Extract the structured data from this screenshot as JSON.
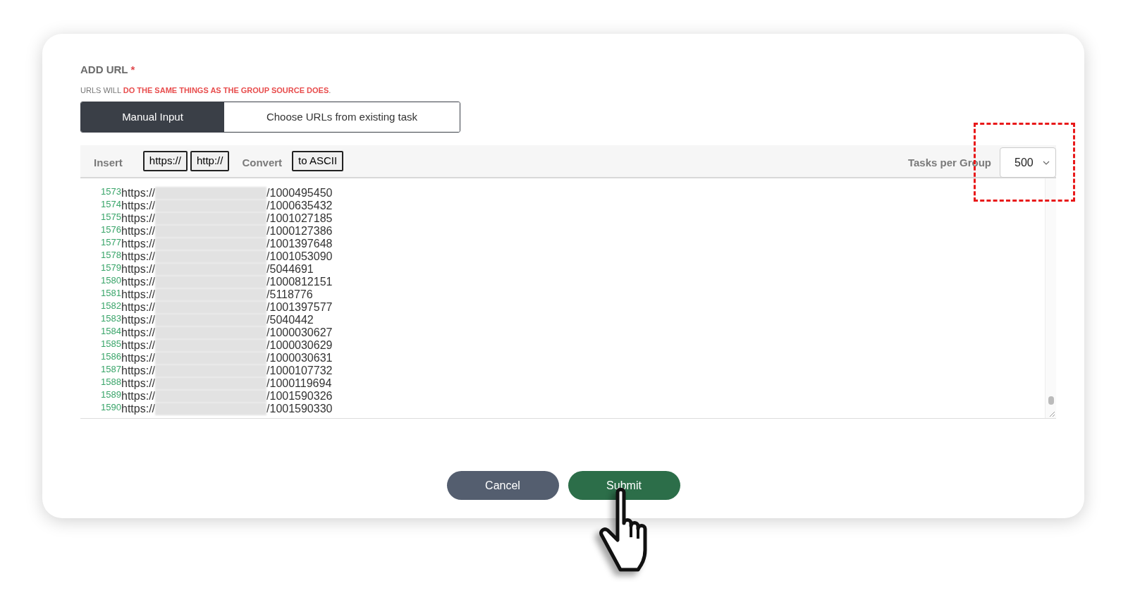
{
  "section": {
    "title": "ADD URL",
    "required_mark": "*",
    "notice": {
      "prefix": "URLS WILL ",
      "emphasis": "DO THE SAME THINGS AS THE GROUP SOURCE DOES",
      "suffix": "."
    }
  },
  "tabs": [
    {
      "label": "Manual Input",
      "selected": true
    },
    {
      "label": "Choose URLs from existing task",
      "selected": false
    }
  ],
  "toolbar": {
    "insert_label": "Insert",
    "insert_buttons": [
      "https://",
      "http://"
    ],
    "convert_label": "Convert",
    "convert_buttons": [
      "to ASCII"
    ],
    "tasks_label": "Tasks per Group",
    "tasks_value": "500"
  },
  "editor": {
    "lines": [
      {
        "number": "1573",
        "prefix": "https://",
        "suffix": "/1000495450"
      },
      {
        "number": "1574",
        "prefix": "https://",
        "suffix": "/1000635432"
      },
      {
        "number": "1575",
        "prefix": "https://",
        "suffix": "/1001027185"
      },
      {
        "number": "1576",
        "prefix": "https://",
        "suffix": "/1000127386"
      },
      {
        "number": "1577",
        "prefix": "https://",
        "suffix": "/1001397648"
      },
      {
        "number": "1578",
        "prefix": "https://",
        "suffix": "/1001053090"
      },
      {
        "number": "1579",
        "prefix": "https://",
        "suffix": "/5044691"
      },
      {
        "number": "1580",
        "prefix": "https://",
        "suffix": "/1000812151"
      },
      {
        "number": "1581",
        "prefix": "https://",
        "suffix": "/5118776"
      },
      {
        "number": "1582",
        "prefix": "https://",
        "suffix": "/1001397577"
      },
      {
        "number": "1583",
        "prefix": "https://",
        "suffix": "/5040442"
      },
      {
        "number": "1584",
        "prefix": "https://",
        "suffix": "/1000030627"
      },
      {
        "number": "1585",
        "prefix": "https://",
        "suffix": "/1000030629"
      },
      {
        "number": "1586",
        "prefix": "https://",
        "suffix": "/1000030631"
      },
      {
        "number": "1587",
        "prefix": "https://",
        "suffix": "/1000107732"
      },
      {
        "number": "1588",
        "prefix": "https://",
        "suffix": "/1000119694"
      },
      {
        "number": "1589",
        "prefix": "https://",
        "suffix": "/1001590326"
      },
      {
        "number": "1590",
        "prefix": "https://",
        "suffix": "/1001590330"
      }
    ]
  },
  "buttons": [
    {
      "kind": "cancel",
      "label": "Cancel"
    },
    {
      "kind": "submit",
      "label": "Submit"
    }
  ]
}
